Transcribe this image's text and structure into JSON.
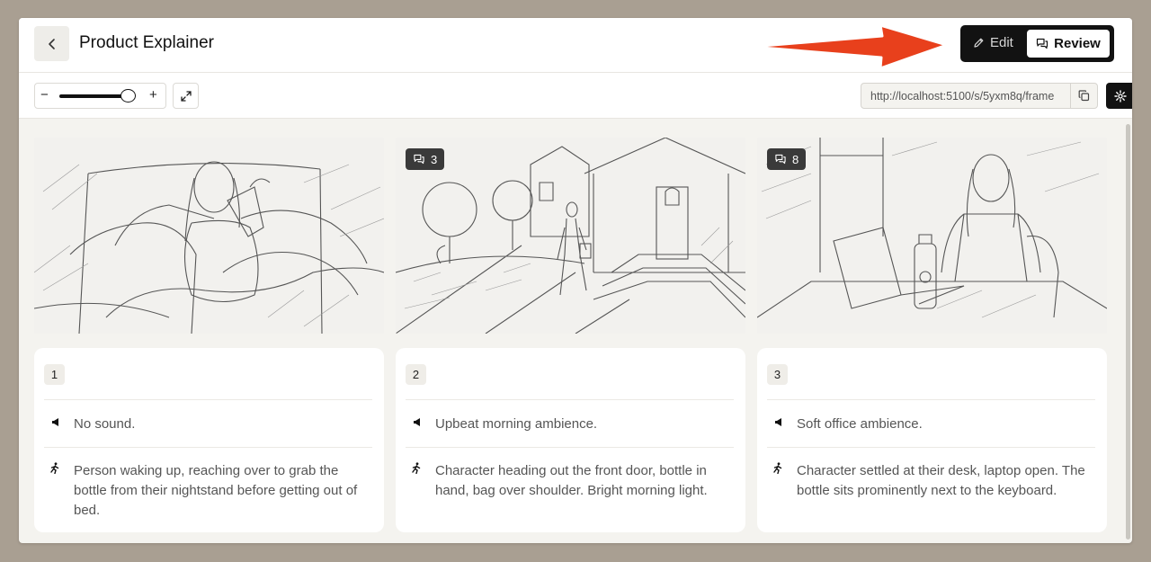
{
  "header": {
    "title": "Product Explainer",
    "modes": {
      "edit_label": "Edit",
      "review_label": "Review",
      "active": "Review"
    }
  },
  "toolbar": {
    "zoom": {
      "minus": "−",
      "plus": "+",
      "level": 0.85
    },
    "url": "http://localhost:5100/s/5yxm8q/frame"
  },
  "annotation": {
    "arrow_color": "#e8401c"
  },
  "frames": [
    {
      "number": "1",
      "comments": null,
      "sound": "No sound.",
      "action": "Person waking up, reaching over to grab the bottle from their nightstand before getting out of bed.",
      "image_icon": "sketch-woman-drinking-in-bed"
    },
    {
      "number": "2",
      "comments": "3",
      "sound": "Upbeat morning ambience.",
      "action": "Character heading out the front door, bottle in hand, bag over shoulder. Bright morning light.",
      "image_icon": "sketch-woman-leaving-house"
    },
    {
      "number": "3",
      "comments": "8",
      "sound": "Soft office ambience.",
      "action": "Character settled at their desk, laptop open. The bottle sits prominently next to the keyboard.",
      "image_icon": "sketch-woman-at-laptop"
    }
  ],
  "colors": {
    "accent": "#121212",
    "page_bg": "#f4f3ef",
    "backdrop": "#a99f92"
  }
}
